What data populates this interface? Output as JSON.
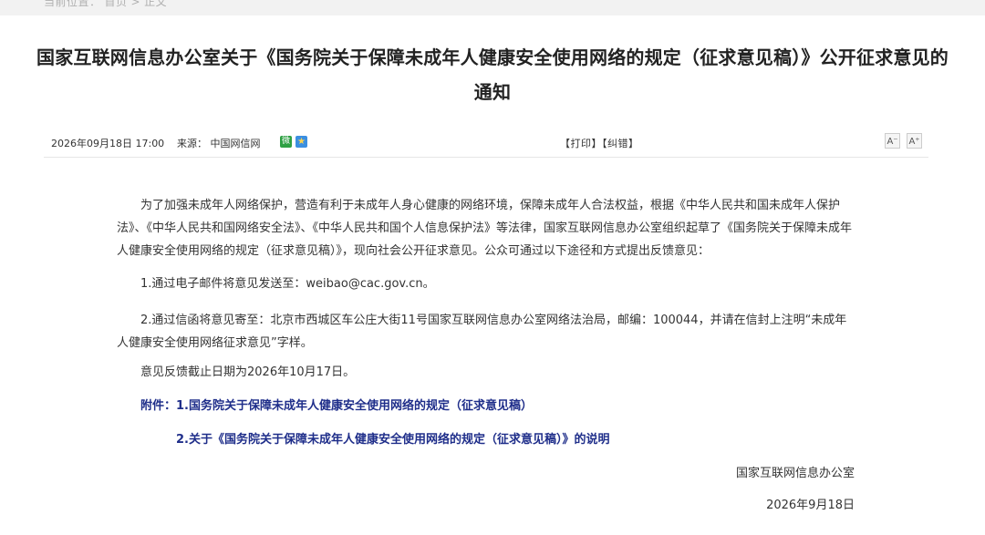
{
  "breadcrumb": [
    "当前位置：",
    "首页",
    ">",
    "正文"
  ],
  "article": {
    "title": "国家互联网信息办公室关于《国务院关于保障未成年人健康安全使用网络的规定（征求意见稿）》公开征求意见的通知"
  },
  "meta": {
    "date": "2026年09月18日  17:00",
    "source": "来源：  中国网信网",
    "share_wechat": "微",
    "share_qzone": "★",
    "actions": "【打印】【纠错】",
    "font_minus": "A⁻",
    "font_plus": "A⁺"
  },
  "body": {
    "p1": "为了加强未成年人网络保护，营造有利于未成年人身心健康的网络环境，保障未成年人合法权益，根据《中华人民共和国未成年人保护法》、《中华人民共和国网络安全法》、《中华人民共和国个人信息保护法》等法律，国家互联网信息办公室组织起草了《国务院关于保障未成年人健康安全使用网络的规定（征求意见稿）》，现向社会公开征求意见。公众可通过以下途径和方式提出反馈意见：",
    "p2": "1.通过电子邮件将意见发送至：weibao@cac.gov.cn。",
    "p3": "2.通过信函将意见寄至：北京市西城区车公庄大街11号国家互联网信息办公室网络法治局，邮编：100044，并请在信封上注明“未成年人健康安全使用网络征求意见”字样。",
    "p4": "意见反馈截止日期为2026年10月17日。"
  },
  "attachments": {
    "a1": "附件：1.国务院关于保障未成年人健康安全使用网络的规定（征求意见稿）",
    "a2": "2.关于《国务院关于保障未成年人健康安全使用网络的规定（征求意见稿）》的说明"
  },
  "signature": {
    "org": "国家互联网信息办公室",
    "date": "2026年9月18日"
  }
}
